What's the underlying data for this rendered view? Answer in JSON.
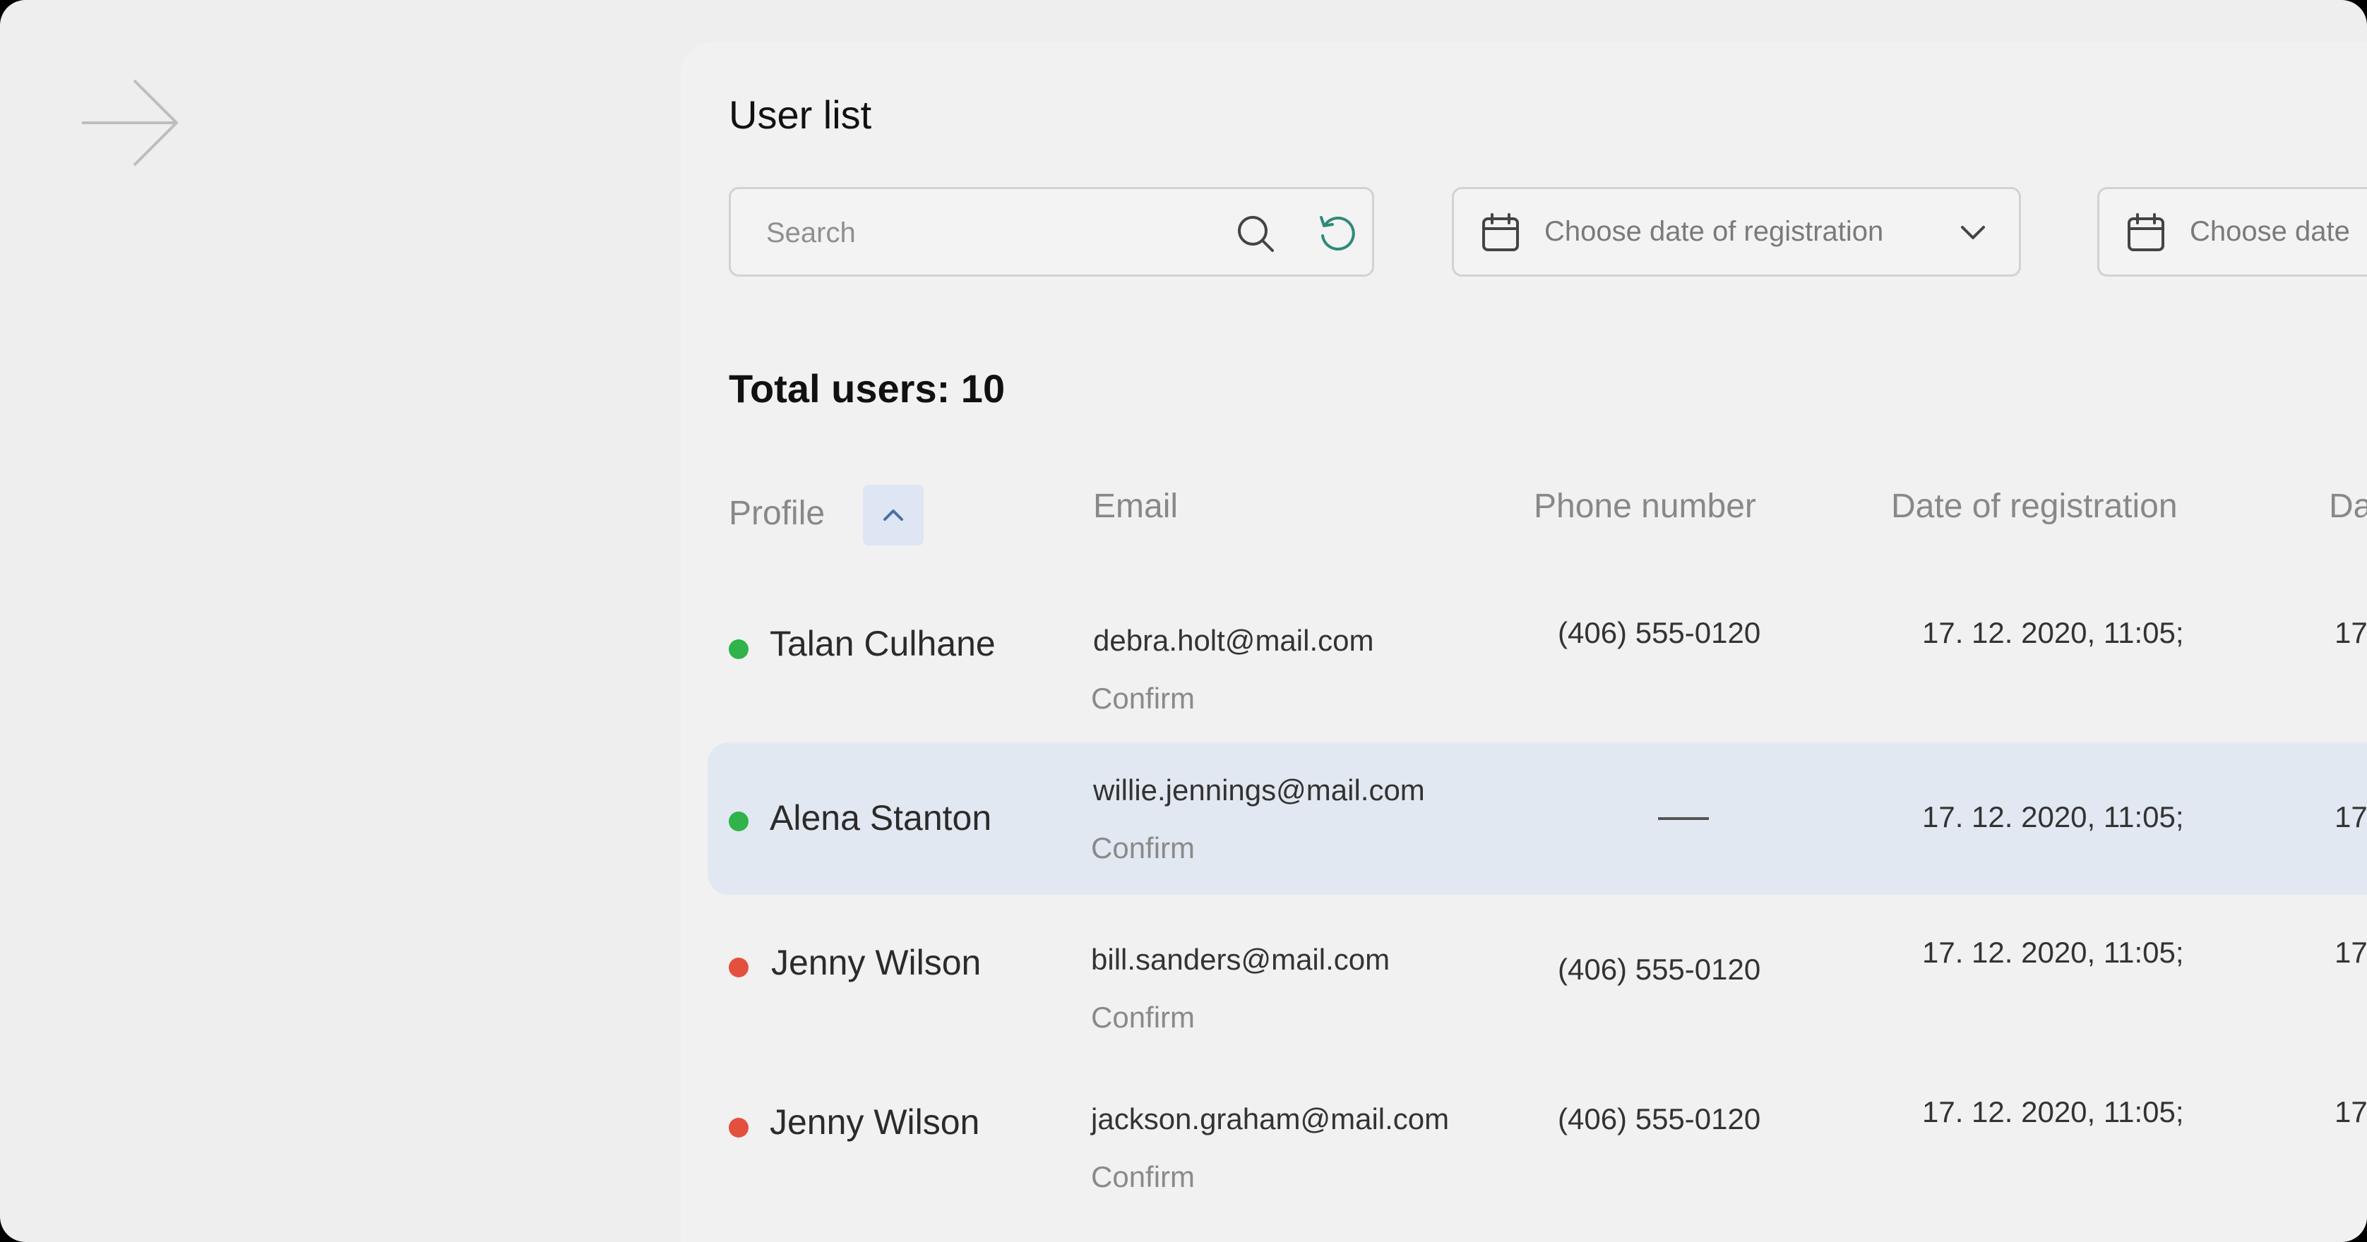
{
  "page": {
    "title": "User list"
  },
  "search": {
    "placeholder": "Search"
  },
  "filters": [
    {
      "label": "Choose date of registration"
    },
    {
      "label": "Choose date"
    }
  ],
  "summary": {
    "total_label": "Total users: 10"
  },
  "table": {
    "columns": [
      "Profile",
      "Email",
      "Phone number",
      "Date of registration",
      "Da"
    ],
    "rows": [
      {
        "name": "Talan Culhane",
        "status": "active",
        "email": "debra.holt@mail.com",
        "confirm": "Confirm",
        "phone": "(406) 555-0120",
        "date": "17. 12. 2020, 11:05;",
        "extra": "17"
      },
      {
        "name": "Alena Stanton",
        "status": "active",
        "email": "willie.jennings@mail.com",
        "confirm": "Confirm",
        "phone": "",
        "date": "17. 12. 2020, 11:05;",
        "extra": "17"
      },
      {
        "name": "Jenny Wilson",
        "status": "inactive",
        "email": "bill.sanders@mail.com",
        "confirm": "Confirm",
        "phone": "(406) 555-0120",
        "date": "17. 12. 2020, 11:05;",
        "extra": "17"
      },
      {
        "name": "Jenny Wilson",
        "status": "inactive",
        "email": "jackson.graham@mail.com",
        "confirm": "Confirm",
        "phone": "(406) 555-0120",
        "date": "17. 12. 2020, 11:05;",
        "extra": "17"
      }
    ]
  },
  "icons": {
    "nav": "arrow-right-icon",
    "search": "search-icon",
    "reset": "refresh-icon",
    "calendar": "calendar-icon",
    "dropdown": "chevron-down-icon",
    "sort": "chevron-up-icon"
  },
  "colors": {
    "status_active": "#2fb34a",
    "status_inactive": "#e3503e",
    "selected_row": "#e2e8f1",
    "sort_button": "#dde6f2"
  }
}
